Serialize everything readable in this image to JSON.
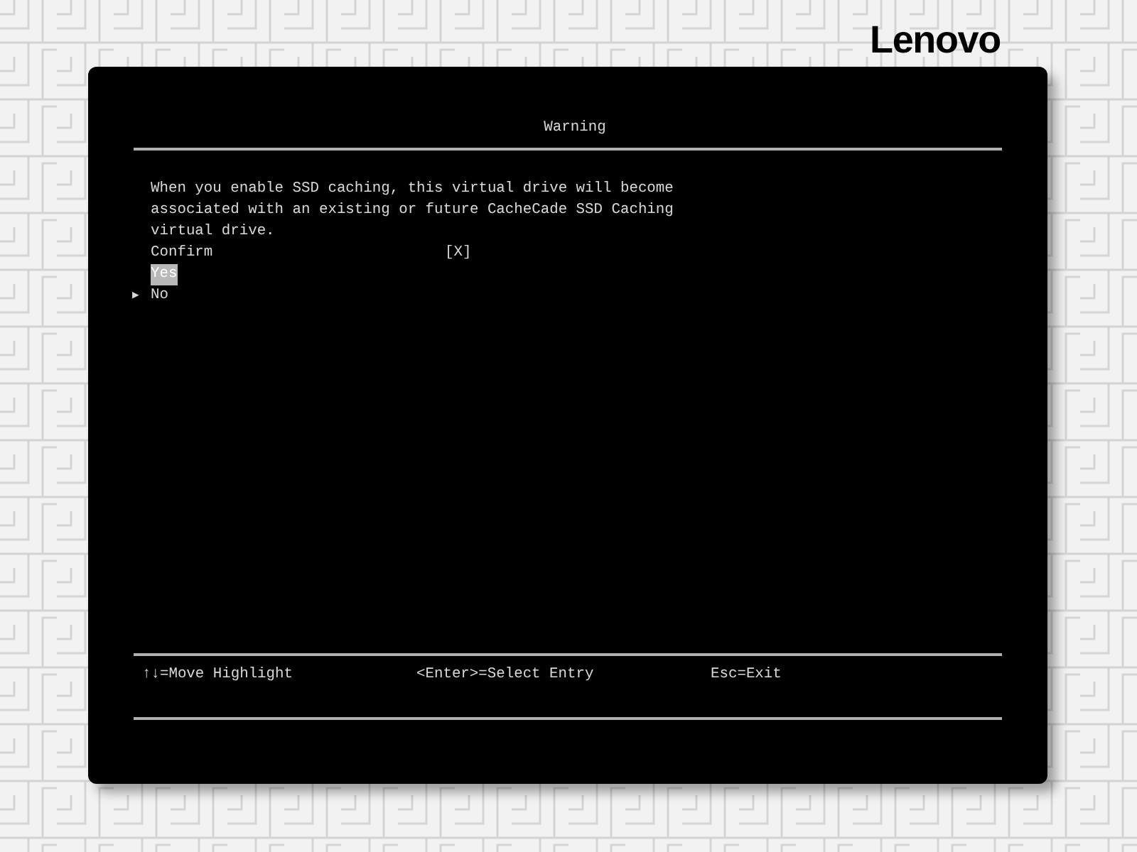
{
  "logo": "Lenovo",
  "dialog": {
    "title": "Warning",
    "message": [
      "When you enable SSD caching, this virtual drive will become",
      "associated with an existing or future CacheCade SSD Caching",
      "virtual drive."
    ],
    "confirm": {
      "label": "Confirm",
      "value": "[X]"
    },
    "options": [
      {
        "label": "Yes",
        "selected": true
      },
      {
        "label": "No",
        "selected": false,
        "marker": "▶"
      }
    ]
  },
  "footer": [
    "↑↓=Move Highlight",
    "<Enter>=Select Entry",
    "Esc=Exit"
  ]
}
